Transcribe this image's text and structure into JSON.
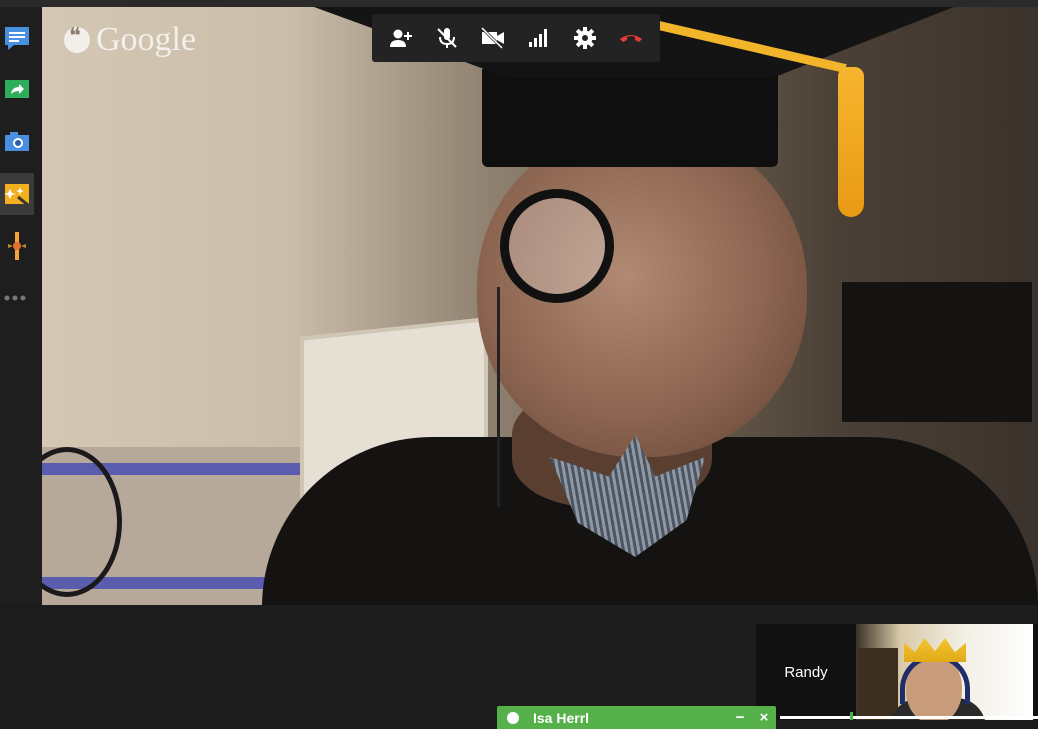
{
  "branding": {
    "logo_text": "Google"
  },
  "toolbar": {
    "buttons": [
      {
        "icon": "invite-person-icon"
      },
      {
        "icon": "mic-muted-icon"
      },
      {
        "icon": "camera-off-icon"
      },
      {
        "icon": "signal-bars-icon"
      },
      {
        "icon": "gear-icon"
      },
      {
        "icon": "hang-up-icon",
        "color": "#e53935"
      }
    ]
  },
  "app_rail": {
    "items": [
      {
        "icon": "chat-icon",
        "color": "#4a90e2"
      },
      {
        "icon": "screen-share-icon",
        "color": "#2eae5b"
      },
      {
        "icon": "camera-icon",
        "color": "#4a90e2"
      },
      {
        "icon": "effects-icon",
        "color": "#f2b01e",
        "active": true
      },
      {
        "icon": "app-icon",
        "color": "#f2a43a"
      },
      {
        "icon": "more-apps-icon"
      }
    ],
    "help_label": "?"
  },
  "participant": {
    "name": "Randy"
  },
  "chat": {
    "contact_name": "Isa Herrl",
    "minimize_label": "−",
    "close_label": "×",
    "status_color": "#ffffff",
    "accent": "#56b14b"
  }
}
